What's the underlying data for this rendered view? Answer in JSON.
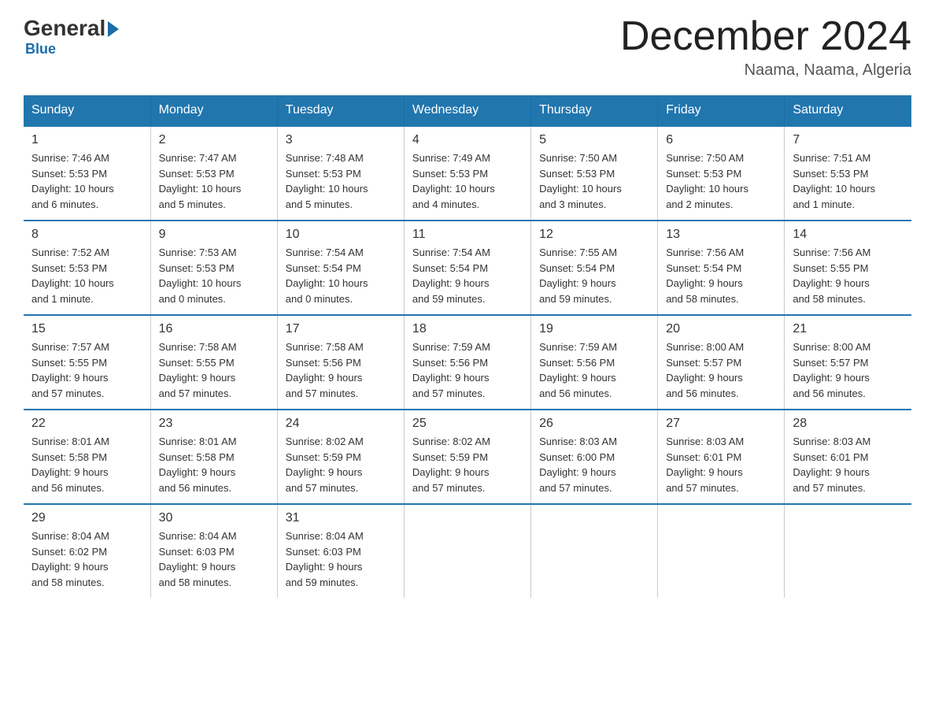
{
  "logo": {
    "general": "General",
    "blue": "Blue",
    "tagline": "Blue"
  },
  "title": "December 2024",
  "location": "Naama, Naama, Algeria",
  "headers": [
    "Sunday",
    "Monday",
    "Tuesday",
    "Wednesday",
    "Thursday",
    "Friday",
    "Saturday"
  ],
  "weeks": [
    [
      {
        "day": "1",
        "info": "Sunrise: 7:46 AM\nSunset: 5:53 PM\nDaylight: 10 hours\nand 6 minutes."
      },
      {
        "day": "2",
        "info": "Sunrise: 7:47 AM\nSunset: 5:53 PM\nDaylight: 10 hours\nand 5 minutes."
      },
      {
        "day": "3",
        "info": "Sunrise: 7:48 AM\nSunset: 5:53 PM\nDaylight: 10 hours\nand 5 minutes."
      },
      {
        "day": "4",
        "info": "Sunrise: 7:49 AM\nSunset: 5:53 PM\nDaylight: 10 hours\nand 4 minutes."
      },
      {
        "day": "5",
        "info": "Sunrise: 7:50 AM\nSunset: 5:53 PM\nDaylight: 10 hours\nand 3 minutes."
      },
      {
        "day": "6",
        "info": "Sunrise: 7:50 AM\nSunset: 5:53 PM\nDaylight: 10 hours\nand 2 minutes."
      },
      {
        "day": "7",
        "info": "Sunrise: 7:51 AM\nSunset: 5:53 PM\nDaylight: 10 hours\nand 1 minute."
      }
    ],
    [
      {
        "day": "8",
        "info": "Sunrise: 7:52 AM\nSunset: 5:53 PM\nDaylight: 10 hours\nand 1 minute."
      },
      {
        "day": "9",
        "info": "Sunrise: 7:53 AM\nSunset: 5:53 PM\nDaylight: 10 hours\nand 0 minutes."
      },
      {
        "day": "10",
        "info": "Sunrise: 7:54 AM\nSunset: 5:54 PM\nDaylight: 10 hours\nand 0 minutes."
      },
      {
        "day": "11",
        "info": "Sunrise: 7:54 AM\nSunset: 5:54 PM\nDaylight: 9 hours\nand 59 minutes."
      },
      {
        "day": "12",
        "info": "Sunrise: 7:55 AM\nSunset: 5:54 PM\nDaylight: 9 hours\nand 59 minutes."
      },
      {
        "day": "13",
        "info": "Sunrise: 7:56 AM\nSunset: 5:54 PM\nDaylight: 9 hours\nand 58 minutes."
      },
      {
        "day": "14",
        "info": "Sunrise: 7:56 AM\nSunset: 5:55 PM\nDaylight: 9 hours\nand 58 minutes."
      }
    ],
    [
      {
        "day": "15",
        "info": "Sunrise: 7:57 AM\nSunset: 5:55 PM\nDaylight: 9 hours\nand 57 minutes."
      },
      {
        "day": "16",
        "info": "Sunrise: 7:58 AM\nSunset: 5:55 PM\nDaylight: 9 hours\nand 57 minutes."
      },
      {
        "day": "17",
        "info": "Sunrise: 7:58 AM\nSunset: 5:56 PM\nDaylight: 9 hours\nand 57 minutes."
      },
      {
        "day": "18",
        "info": "Sunrise: 7:59 AM\nSunset: 5:56 PM\nDaylight: 9 hours\nand 57 minutes."
      },
      {
        "day": "19",
        "info": "Sunrise: 7:59 AM\nSunset: 5:56 PM\nDaylight: 9 hours\nand 56 minutes."
      },
      {
        "day": "20",
        "info": "Sunrise: 8:00 AM\nSunset: 5:57 PM\nDaylight: 9 hours\nand 56 minutes."
      },
      {
        "day": "21",
        "info": "Sunrise: 8:00 AM\nSunset: 5:57 PM\nDaylight: 9 hours\nand 56 minutes."
      }
    ],
    [
      {
        "day": "22",
        "info": "Sunrise: 8:01 AM\nSunset: 5:58 PM\nDaylight: 9 hours\nand 56 minutes."
      },
      {
        "day": "23",
        "info": "Sunrise: 8:01 AM\nSunset: 5:58 PM\nDaylight: 9 hours\nand 56 minutes."
      },
      {
        "day": "24",
        "info": "Sunrise: 8:02 AM\nSunset: 5:59 PM\nDaylight: 9 hours\nand 57 minutes."
      },
      {
        "day": "25",
        "info": "Sunrise: 8:02 AM\nSunset: 5:59 PM\nDaylight: 9 hours\nand 57 minutes."
      },
      {
        "day": "26",
        "info": "Sunrise: 8:03 AM\nSunset: 6:00 PM\nDaylight: 9 hours\nand 57 minutes."
      },
      {
        "day": "27",
        "info": "Sunrise: 8:03 AM\nSunset: 6:01 PM\nDaylight: 9 hours\nand 57 minutes."
      },
      {
        "day": "28",
        "info": "Sunrise: 8:03 AM\nSunset: 6:01 PM\nDaylight: 9 hours\nand 57 minutes."
      }
    ],
    [
      {
        "day": "29",
        "info": "Sunrise: 8:04 AM\nSunset: 6:02 PM\nDaylight: 9 hours\nand 58 minutes."
      },
      {
        "day": "30",
        "info": "Sunrise: 8:04 AM\nSunset: 6:03 PM\nDaylight: 9 hours\nand 58 minutes."
      },
      {
        "day": "31",
        "info": "Sunrise: 8:04 AM\nSunset: 6:03 PM\nDaylight: 9 hours\nand 59 minutes."
      },
      null,
      null,
      null,
      null
    ]
  ]
}
